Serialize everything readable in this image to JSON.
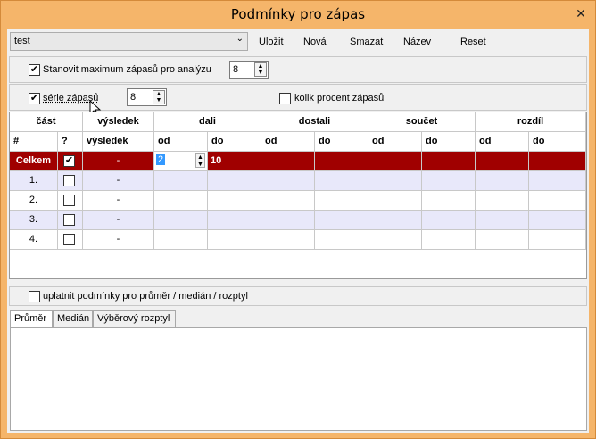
{
  "window": {
    "title": "Podmínky pro zápas",
    "close_glyph": "✕"
  },
  "toolbar": {
    "combo_value": "test",
    "save": "Uložit",
    "new": "Nová",
    "delete": "Smazat",
    "name": "Název",
    "reset": "Reset"
  },
  "options": {
    "max_matches_label": "Stanovit maximum zápasů pro analýzu",
    "max_matches_checked": true,
    "max_matches_value": "8",
    "series_label": "série zápasů",
    "series_checked": true,
    "series_value": "8",
    "percent_label": "kolik procent zápasů",
    "percent_checked": false
  },
  "grid": {
    "group_headers": [
      "část",
      "výsledek",
      "dali",
      "dostali",
      "součet",
      "rozdíl"
    ],
    "sub_headers": [
      "#",
      "?",
      "výsledek",
      "od",
      "do",
      "od",
      "do",
      "od",
      "do",
      "od",
      "do"
    ],
    "rows": [
      {
        "label": "Celkem",
        "checked": true,
        "result": "-",
        "dali_od": "2",
        "dali_do": "10"
      },
      {
        "label": "1.",
        "checked": false,
        "result": "-",
        "dali_od": "",
        "dali_do": ""
      },
      {
        "label": "2.",
        "checked": false,
        "result": "-",
        "dali_od": "",
        "dali_do": ""
      },
      {
        "label": "3.",
        "checked": false,
        "result": "-",
        "dali_od": "",
        "dali_do": ""
      },
      {
        "label": "4.",
        "checked": false,
        "result": "-",
        "dali_od": "",
        "dali_do": ""
      }
    ],
    "colors": {
      "selected_row": "#a00000",
      "alt_row": "#e8e8fa"
    }
  },
  "bottom": {
    "apply_label": "uplatnit podmínky pro průměr / medián / rozptyl",
    "apply_checked": false,
    "tabs": [
      "Průměr",
      "Medián",
      "Výběrový rozptyl"
    ]
  }
}
